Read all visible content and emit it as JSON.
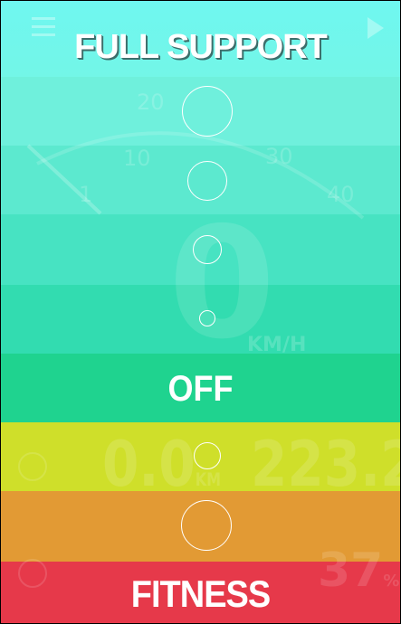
{
  "header": {
    "title": "FULL SUPPORT"
  },
  "levels": {
    "off_label": "OFF",
    "fitness_label": "FITNESS"
  },
  "background": {
    "speed_value": "0",
    "speed_unit": "KM/H",
    "gauge_ticks": [
      "1",
      "10",
      "20",
      "30",
      "40"
    ],
    "trip_distance": "0.0",
    "total_distance": "223.2",
    "distance_unit": "KM",
    "battery_value": "37",
    "battery_unit": "%"
  },
  "colors": {
    "band_top": "#6ff7f0",
    "band_off": "#1fd38f",
    "band_yellow": "#cfdf2a",
    "band_orange": "#e29a34",
    "band_red": "#e6394a"
  },
  "icons": {
    "menu": "menu-icon",
    "play": "play-icon",
    "compass": "compass-icon",
    "bike": "bike-icon",
    "gauge": "gauge-icon"
  }
}
